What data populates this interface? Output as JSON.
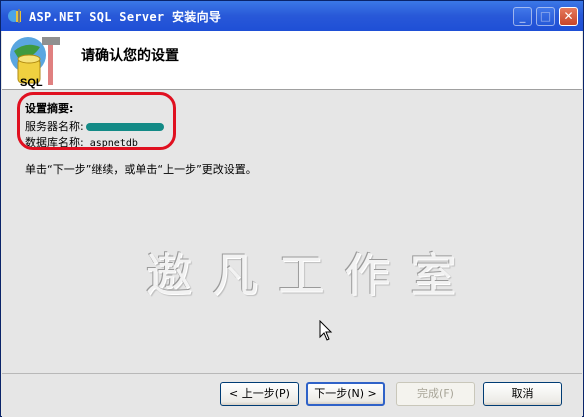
{
  "window": {
    "title": "ASP.NET SQL Server 安装向导",
    "controls": {
      "minimize": "_",
      "maximize": "□",
      "close": "✕"
    }
  },
  "header": {
    "title": "请确认您的设置",
    "icon": "sql-wizard-icon",
    "icon_text": "SQL"
  },
  "summary": {
    "label": "设置摘要:",
    "server_name_label": "服务器名称:",
    "database_name_label": "数据库名称:",
    "database_name_value": "aspnetdb"
  },
  "instruction": "单击“下一步”继续，或单击“上一步”更改设置。",
  "watermark": "遨凡工作室",
  "buttons": {
    "back": "< 上一步(P)",
    "next": "下一步(N) >",
    "finish": "完成(F)",
    "cancel": "取消"
  },
  "colors": {
    "titlebar": "#2858d8",
    "highlight": "#e01020",
    "redacted": "#138a86"
  }
}
